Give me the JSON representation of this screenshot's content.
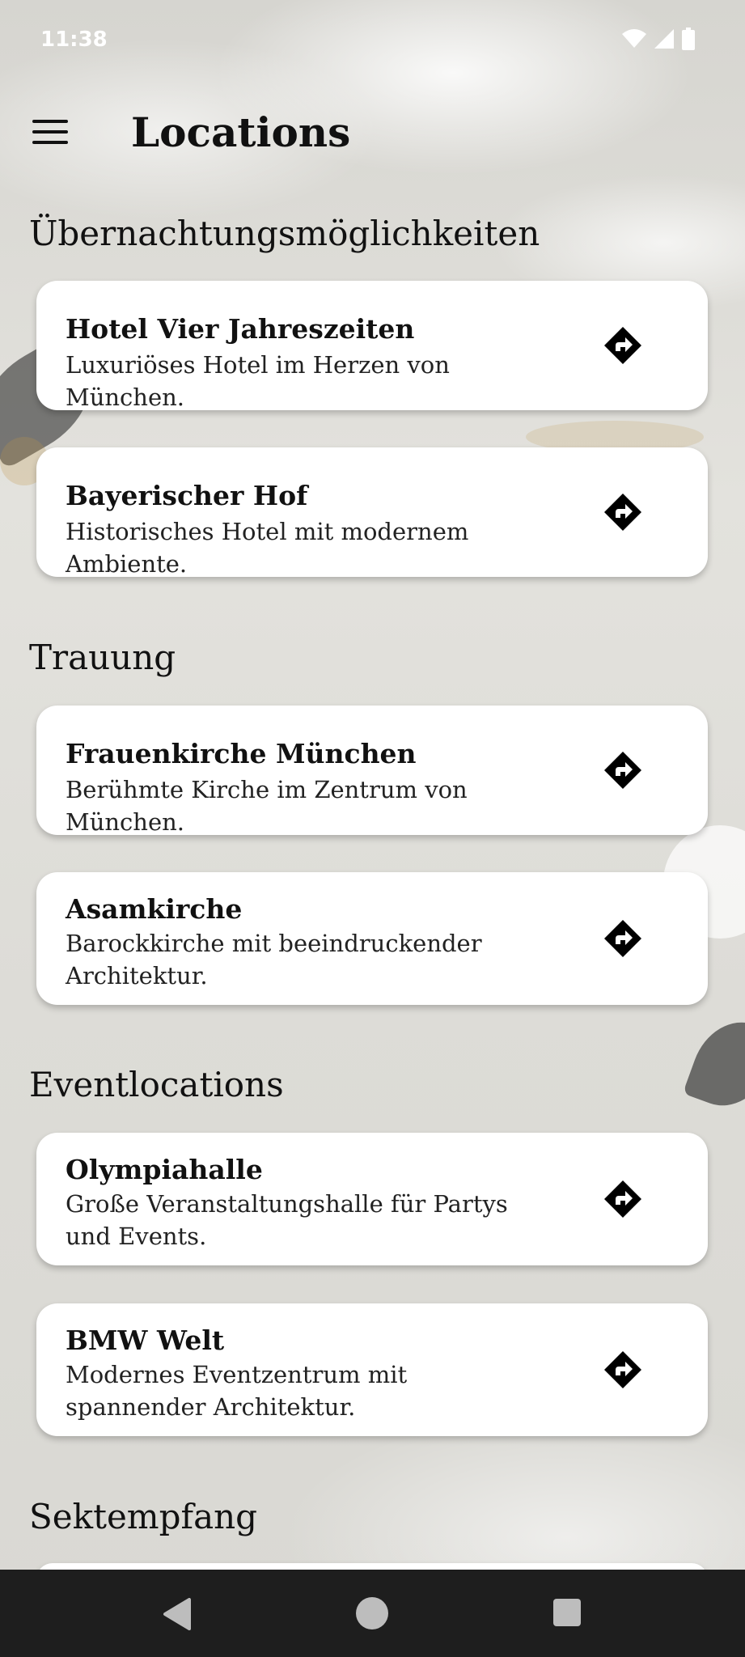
{
  "status": {
    "time": "11:38"
  },
  "appbar": {
    "title": "Locations",
    "menu_icon": "menu-icon"
  },
  "sections": [
    {
      "title": "Übernachtungsmöglichkeiten",
      "cards": [
        {
          "title": "Hotel Vier Jahreszeiten",
          "desc": "Luxuriöses Hotel im Herzen von München."
        },
        {
          "title": "Bayerischer Hof",
          "desc": "Historisches Hotel mit modernem Ambiente."
        }
      ]
    },
    {
      "title": "Trauung",
      "cards": [
        {
          "title": "Frauenkirche München",
          "desc": "Berühmte Kirche im Zentrum von München."
        },
        {
          "title": "Asamkirche",
          "desc": "Barockkirche mit beeindruckender Architektur."
        }
      ]
    },
    {
      "title": "Eventlocations",
      "cards": [
        {
          "title": "Olympiahalle",
          "desc": "Große Veranstaltungshalle für Partys und Events."
        },
        {
          "title": "BMW Welt",
          "desc": "Modernes Eventzentrum mit spannender Architektur."
        }
      ]
    },
    {
      "title": "Sektempfang",
      "cards": []
    }
  ],
  "icons": {
    "directions": "directions-icon"
  },
  "colors": {
    "card_bg": "#ffffff",
    "text": "#111111",
    "navbar": "#1e1e1e"
  }
}
